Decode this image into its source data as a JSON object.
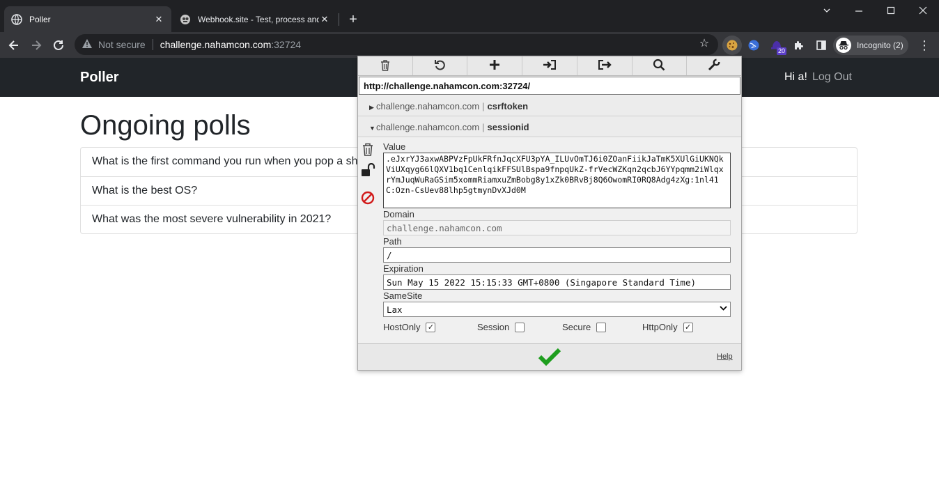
{
  "browser": {
    "tabs": [
      {
        "title": "Poller",
        "active": true
      },
      {
        "title": "Webhook.site - Test, process and",
        "active": false
      }
    ],
    "new_tab": "+",
    "address": {
      "security_label": "Not secure",
      "host": "challenge.nahamcon.com",
      "port": ":32724"
    },
    "extension_badge": "20",
    "profile_label": "Incognito (2)"
  },
  "page": {
    "brand": "Poller",
    "greeting": "Hi a!",
    "logout": "Log Out",
    "heading": "Ongoing polls",
    "polls": [
      "What is the first command you run when you pop a shell?",
      "What is the best OS?",
      "What was the most severe vulnerability in 2021?"
    ]
  },
  "cookie_editor": {
    "url": "http://challenge.nahamcon.com:32724/",
    "cookies": [
      {
        "domain": "challenge.nahamcon.com",
        "separator": "|",
        "name": "csrftoken",
        "expanded": false
      },
      {
        "domain": "challenge.nahamcon.com",
        "separator": "|",
        "name": "sessionid",
        "expanded": true
      }
    ],
    "labels": {
      "value": "Value",
      "domain": "Domain",
      "path": "Path",
      "expiration": "Expiration",
      "samesite": "SameSite",
      "hostonly": "HostOnly",
      "session": "Session",
      "secure": "Secure",
      "httponly": "HttpOnly",
      "help": "Help"
    },
    "fields": {
      "value": ".eJxrYJ3axwABPVzFpUkFRfnJqcXFU3pYA_ILUvOmTJ6i0ZOanFiikJaTmK5XUlGiUKNQkViUXqyg66lQXV1bq1CenlqikFFSUlBspa9fnpqUkZ-frVecWZKqn2qcbJ6YYpqmm2iWlqxrYmJuqWuRaGSim5xommRiamxuZmBobg8y1xZk0BRvBj8Q6OwomRI0RQ8Adg4zXg:1nl41C:Ozn-CsUev88lhp5gtmynDvXJd0M",
      "domain": "challenge.nahamcon.com",
      "path": "/",
      "expiration": "Sun May 15 2022 15:15:33 GMT+0800 (Singapore Standard Time)",
      "samesite": "Lax"
    },
    "flags": {
      "hostonly": true,
      "session": false,
      "secure": false,
      "httponly": true
    }
  },
  "colors": {
    "chrome_dark": "#202124",
    "chrome_toolbar": "#35363a",
    "site_nav": "#212529",
    "confirm_green": "#1e9e1e",
    "block_red": "#d11a1a"
  }
}
